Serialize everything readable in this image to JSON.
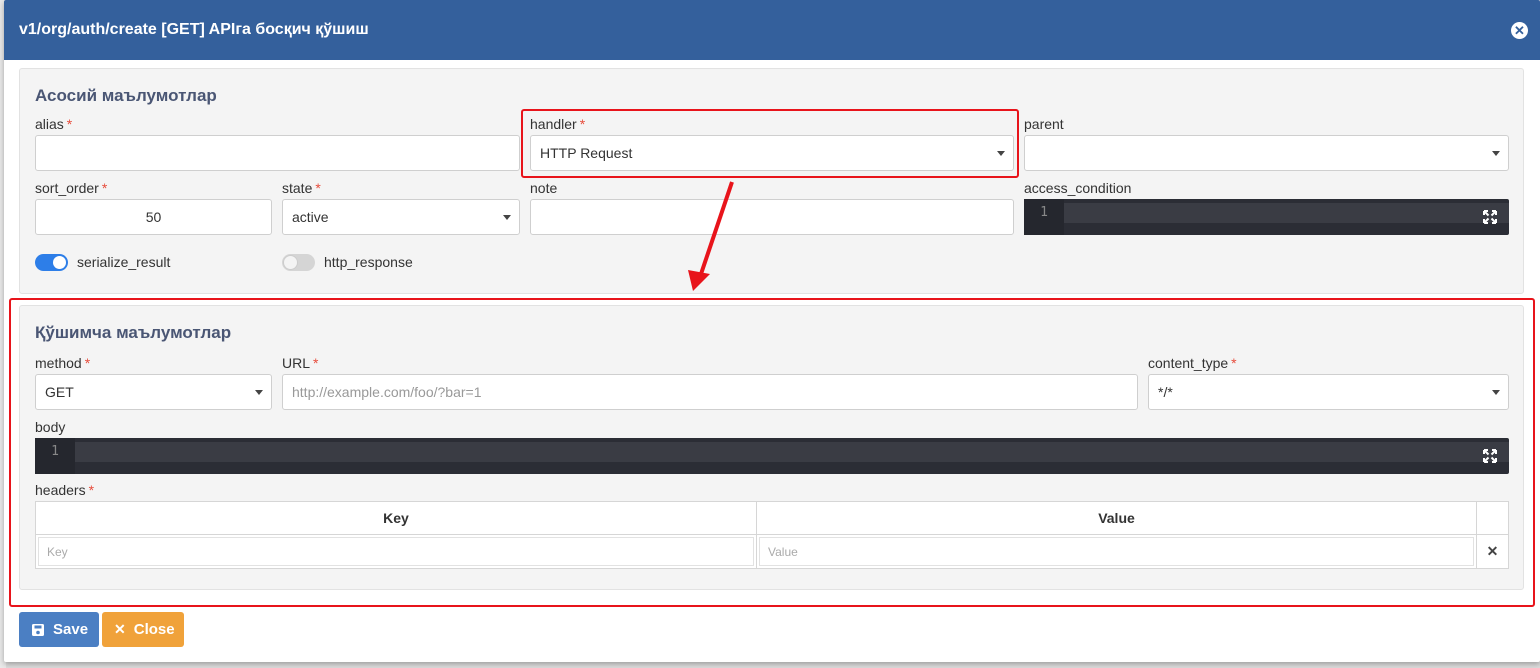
{
  "modal": {
    "title": "v1/org/auth/create [GET] APIга босқич қўшиш"
  },
  "main_section": {
    "title": "Асосий маълумотлар",
    "alias": {
      "label": "alias",
      "value": ""
    },
    "handler": {
      "label": "handler",
      "value": "HTTP Request"
    },
    "parent": {
      "label": "parent",
      "value": ""
    },
    "sort_order": {
      "label": "sort_order",
      "value": "50"
    },
    "state": {
      "label": "state",
      "value": "active"
    },
    "note": {
      "label": "note",
      "value": ""
    },
    "access_condition": {
      "label": "access_condition",
      "line_number": "1"
    },
    "serialize_result": {
      "label": "serialize_result",
      "enabled": true
    },
    "http_response": {
      "label": "http_response",
      "enabled": false
    },
    "required_mark": "*"
  },
  "extra_section": {
    "title": "Қўшимча маълумотлар",
    "method": {
      "label": "method",
      "value": "GET"
    },
    "url": {
      "label": "URL",
      "placeholder": "http://example.com/foo/?bar=1"
    },
    "content_type": {
      "label": "content_type",
      "value": "*/*"
    },
    "body": {
      "label": "body",
      "line_number": "1"
    },
    "headers": {
      "label": "headers",
      "columns": [
        "Key",
        "Value"
      ],
      "row": {
        "key_placeholder": "Key",
        "value_placeholder": "Value"
      }
    }
  },
  "buttons": {
    "save": "Save",
    "close": "Close"
  },
  "colors": {
    "header": "#34609c",
    "highlight": "#e8141b",
    "save": "#4b7fc3",
    "close": "#f0a23a",
    "toggle_on": "#2d7ee8"
  },
  "icons": [
    "close-circle-icon",
    "caret-down-icon",
    "expand-icon",
    "floppy-disk-icon",
    "times-icon",
    "arrow-annotation"
  ]
}
